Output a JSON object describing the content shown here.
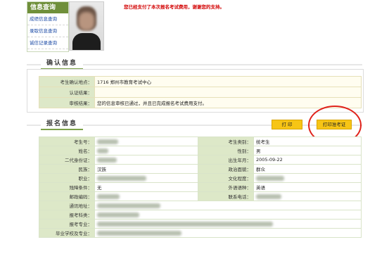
{
  "info_panel": {
    "title": "信息查询",
    "links": [
      "成绩信息查询",
      "录取信息查询",
      "诚信记录查询"
    ]
  },
  "notice": "您已经支付了本次报名考试费用，谢谢您的支持。",
  "confirm": {
    "header": "确认信息",
    "rows": [
      {
        "label": "考生确认地点：",
        "value": "1716  郑州市教育考试中心"
      },
      {
        "label": "认证结果：",
        "value": ""
      },
      {
        "label": "审核结果：",
        "value": "您的信息审核已通过，并且已完成报名考试费用支付。"
      }
    ]
  },
  "apply": {
    "header": "报名信息",
    "print_button": "打  印",
    "print_ticket_button": "打印准考证",
    "rows": [
      {
        "l1": "考生号：",
        "v1": "",
        "l2": "考生类别：",
        "v2": "统考生"
      },
      {
        "l1": "姓名：",
        "v1": "",
        "l2": "性别：",
        "v2": "男"
      },
      {
        "l1": "二代身份证：",
        "v1": "",
        "l2": "出生年月：",
        "v2": "2005-09-22"
      },
      {
        "l1": "民族：",
        "v1": "汉族",
        "l2": "政治面貌：",
        "v2": "群众"
      },
      {
        "l1": "职业：",
        "v1": "",
        "l2": "文化程度：",
        "v2": ""
      },
      {
        "l1": "残障条件：",
        "v1": "无",
        "l2": "外语语种：",
        "v2": "英语"
      },
      {
        "l1": "邮政编码：",
        "v1": "",
        "l2": "联系电话：",
        "v2": ""
      },
      {
        "l1": "通讯地址：",
        "v1": ""
      },
      {
        "l1": "报考科类：",
        "v1": ""
      },
      {
        "l1": "报考专业：",
        "v1": ""
      },
      {
        "l1": "毕业学校及专业：",
        "v1": ""
      }
    ]
  }
}
